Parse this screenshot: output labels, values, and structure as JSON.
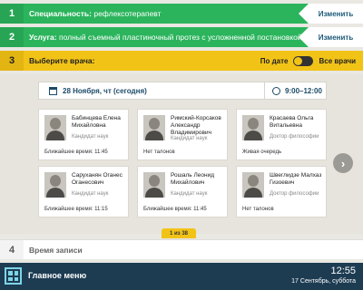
{
  "steps": [
    {
      "num": "1",
      "label": "Специальность:",
      "value": "рефлексотерапевт",
      "change": "Изменить"
    },
    {
      "num": "2",
      "label": "Услуга:",
      "value": "полный съемный пластиночный протез с усложненной постановкой...",
      "change": "Изменить"
    },
    {
      "num": "3",
      "label": "Выберите врача:"
    },
    {
      "num": "4",
      "label": "Время записи"
    }
  ],
  "toggle": {
    "left": "По дате",
    "right": "Все врачи"
  },
  "datebar": {
    "date": "28 Ноября, чт (сегодня)",
    "time": "9:00–12:00"
  },
  "doctors": [
    {
      "name": "Бабинцева Елена Михайловна",
      "title": "Кандидат наук",
      "slot": "Ближайшее время: 11:45"
    },
    {
      "name": "Римский-Корсаков Александр Владимирович",
      "title": "Кандидат наук",
      "slot": "Нет талонов"
    },
    {
      "name": "Красаева Ольга Витальевна",
      "title": "Доктор философии",
      "slot": "Живая очередь"
    },
    {
      "name": "Саруханян Оганес Оганесович",
      "title": "Кандидат наук",
      "slot": "Ближайшее время: 11:15"
    },
    {
      "name": "Рошаль Леонид Михайлович",
      "title": "Кандидат наук",
      "slot": "Ближайшее время: 11:45"
    },
    {
      "name": "Швеглидзе Малхаз Гизоевич",
      "title": "Доктор философии",
      "slot": "Нет талонов"
    }
  ],
  "pager": "1 из 38",
  "footer": {
    "menu": "Главное меню",
    "time": "12:55",
    "date": "17 Сентябрь, суббота"
  },
  "colors": {
    "green": "#2bb45c",
    "yellow": "#f2c317",
    "navy": "#1d3c52"
  }
}
